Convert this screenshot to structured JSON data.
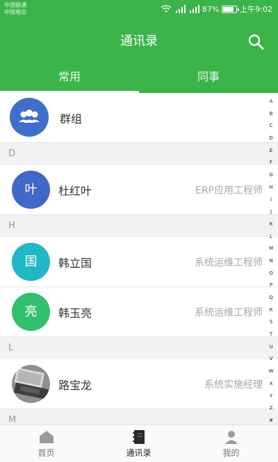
{
  "statusbar": {
    "carrier_1": "中国联通",
    "carrier_2": "中国电信",
    "battery_percent": "87%",
    "battery_level": 0.87,
    "time": "上午9:02"
  },
  "header": {
    "title": "通讯录",
    "tabs": [
      {
        "label": "常用",
        "active": true
      },
      {
        "label": "同事",
        "active": false
      }
    ]
  },
  "list": {
    "group": {
      "label": "群组"
    },
    "sections": [
      "D",
      "H",
      "L",
      "M"
    ],
    "contacts": [
      {
        "avatar_text": "叶",
        "name": "杜红叶",
        "role": "ERP应用工程师",
        "color": "#3f68c7"
      },
      {
        "avatar_text": "国",
        "name": "韩立国",
        "role": "系统运维工程师",
        "color": "#1fb8c4"
      },
      {
        "avatar_text": "亮",
        "name": "韩玉亮",
        "role": "系统运维工程师",
        "color": "#30c06e"
      },
      {
        "avatar_text": "",
        "name": "路宝龙",
        "role": "系统实施经理",
        "color": "#6d6d6d"
      }
    ]
  },
  "index_letters": [
    "A",
    "B",
    "C",
    "D",
    "E",
    "F",
    "G",
    "H",
    "I",
    "J",
    "K",
    "L",
    "M",
    "N",
    "O",
    "P",
    "Q",
    "R",
    "S",
    "T",
    "U",
    "V",
    "W",
    "X",
    "Y",
    "Z",
    "#"
  ],
  "bottom_nav": [
    {
      "label": "首页",
      "icon": "home-icon",
      "active": false
    },
    {
      "label": "通讯录",
      "icon": "address-book-icon",
      "active": true
    },
    {
      "label": "我的",
      "icon": "person-icon",
      "active": false
    }
  ],
  "colors": {
    "brand_green": "#3bb44a"
  }
}
